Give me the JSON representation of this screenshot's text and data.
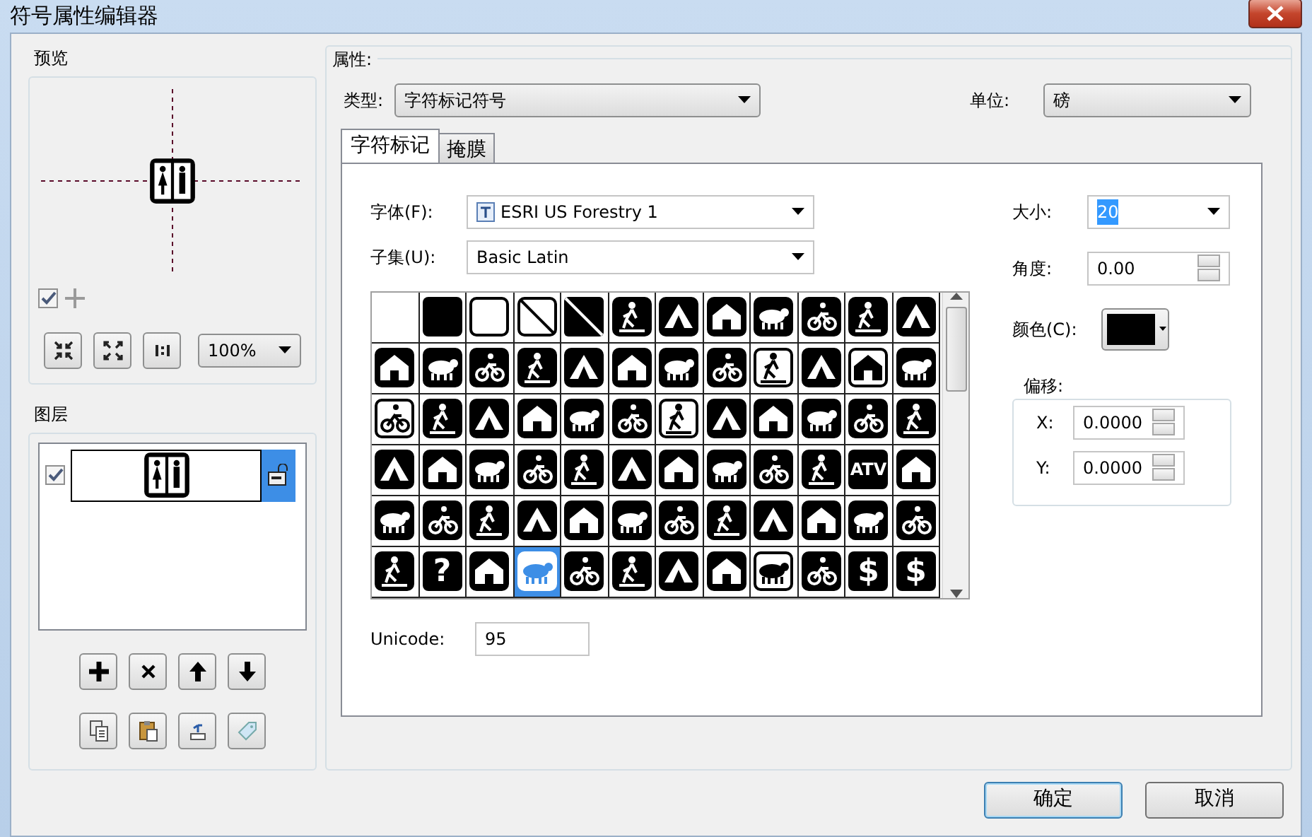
{
  "window": {
    "title": "符号属性编辑器"
  },
  "preview": {
    "label": "预览",
    "crosshair_checked": true,
    "zoom": "100%"
  },
  "layers": {
    "label": "图层",
    "items": [
      {
        "visible": true,
        "selected": true
      }
    ]
  },
  "properties": {
    "label": "属性:",
    "type_label": "类型:",
    "type_value": "字符标记符号",
    "unit_label": "单位:",
    "unit_value": "磅",
    "tabs": [
      {
        "label": "字符标记",
        "selected": true
      },
      {
        "label": "掩膜",
        "selected": false
      }
    ],
    "font_label": "字体(F):",
    "font_value": "ESRI US Forestry 1",
    "subset_label": "子集(U):",
    "subset_value": "Basic Latin",
    "glyphs": [
      {
        "kind": "empty",
        "selected": false
      },
      {
        "kind": "filled",
        "selected": false
      },
      {
        "kind": "outlined",
        "selected": false
      },
      {
        "kind": "slashed",
        "selected": false
      },
      {
        "kind": "slashed-filled",
        "selected": false
      },
      {
        "kind": "figure",
        "selected": false
      },
      {
        "kind": "figure",
        "selected": false
      },
      {
        "kind": "figure",
        "selected": false
      },
      {
        "kind": "figure",
        "selected": false
      },
      {
        "kind": "figure",
        "selected": false
      },
      {
        "kind": "figure",
        "selected": false
      },
      {
        "kind": "figure",
        "selected": false
      },
      {
        "kind": "figure",
        "selected": false
      },
      {
        "kind": "figure",
        "selected": false
      },
      {
        "kind": "figure",
        "selected": false
      },
      {
        "kind": "figure",
        "selected": false
      },
      {
        "kind": "figure",
        "selected": false
      },
      {
        "kind": "figure",
        "selected": false
      },
      {
        "kind": "figure",
        "selected": false
      },
      {
        "kind": "figure",
        "selected": false
      },
      {
        "kind": "figure-outlined",
        "selected": false
      },
      {
        "kind": "figure",
        "selected": false
      },
      {
        "kind": "figure-outlined",
        "selected": false
      },
      {
        "kind": "figure",
        "selected": false
      },
      {
        "kind": "figure-outlined",
        "selected": false
      },
      {
        "kind": "figure",
        "selected": false
      },
      {
        "kind": "figure",
        "selected": false
      },
      {
        "kind": "figure",
        "selected": false
      },
      {
        "kind": "figure",
        "selected": false
      },
      {
        "kind": "figure",
        "selected": false
      },
      {
        "kind": "figure-outlined",
        "selected": false
      },
      {
        "kind": "figure",
        "selected": false
      },
      {
        "kind": "figure",
        "selected": false
      },
      {
        "kind": "figure",
        "selected": false
      },
      {
        "kind": "figure",
        "selected": false
      },
      {
        "kind": "figure",
        "selected": false
      },
      {
        "kind": "figure",
        "selected": false
      },
      {
        "kind": "figure",
        "selected": false
      },
      {
        "kind": "figure",
        "selected": false
      },
      {
        "kind": "figure",
        "selected": false
      },
      {
        "kind": "figure",
        "selected": false
      },
      {
        "kind": "figure",
        "selected": false
      },
      {
        "kind": "figure",
        "selected": false
      },
      {
        "kind": "figure",
        "selected": false
      },
      {
        "kind": "figure",
        "selected": false
      },
      {
        "kind": "figure",
        "selected": false
      },
      {
        "kind": "letters",
        "text": "ATV",
        "selected": false
      },
      {
        "kind": "figure",
        "selected": false
      },
      {
        "kind": "figure",
        "selected": false
      },
      {
        "kind": "figure",
        "selected": false
      },
      {
        "kind": "figure",
        "selected": false
      },
      {
        "kind": "figure",
        "selected": false
      },
      {
        "kind": "figure",
        "selected": false
      },
      {
        "kind": "figure",
        "selected": false
      },
      {
        "kind": "figure",
        "selected": false
      },
      {
        "kind": "figure",
        "selected": false
      },
      {
        "kind": "figure",
        "selected": false
      },
      {
        "kind": "figure",
        "selected": false
      },
      {
        "kind": "figure",
        "selected": false
      },
      {
        "kind": "figure",
        "selected": false
      },
      {
        "kind": "figure",
        "selected": false
      },
      {
        "kind": "letters",
        "text": "?",
        "selected": false
      },
      {
        "kind": "figure",
        "selected": false
      },
      {
        "kind": "figure",
        "selected": true
      },
      {
        "kind": "figure",
        "selected": false
      },
      {
        "kind": "figure",
        "selected": false
      },
      {
        "kind": "figure",
        "selected": false
      },
      {
        "kind": "figure",
        "selected": false
      },
      {
        "kind": "figure-outlined",
        "selected": false
      },
      {
        "kind": "figure",
        "selected": false
      },
      {
        "kind": "letters",
        "text": "$",
        "selected": false
      },
      {
        "kind": "letters",
        "text": "$",
        "selected": false
      }
    ],
    "unicode_label": "Unicode:",
    "unicode_value": "95",
    "size_label": "大小:",
    "size_value": "20",
    "angle_label": "角度:",
    "angle_value": "0.00",
    "color_label": "颜色(C):",
    "offset_label": "偏移:",
    "x_label": "X:",
    "x_value": "0.0000",
    "y_label": "Y:",
    "y_value": "0.0000"
  },
  "buttons": [
    {
      "label": "确定",
      "default": true
    },
    {
      "label": "取消",
      "default": false
    }
  ]
}
